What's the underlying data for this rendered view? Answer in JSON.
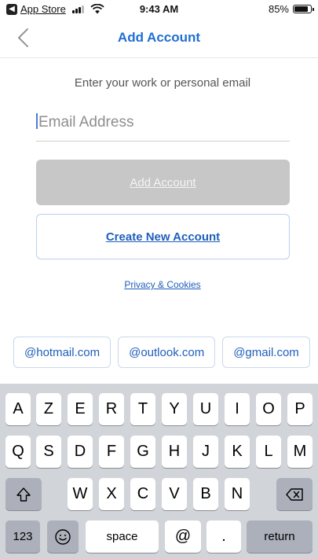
{
  "status_bar": {
    "back_app": "App Store",
    "time": "9:43 AM",
    "battery": "85%",
    "battery_level": 0.85
  },
  "nav": {
    "title": "Add Account"
  },
  "form": {
    "prompt": "Enter your work or personal email",
    "email_placeholder": "Email Address",
    "email_value": "",
    "add_button": "Add Account",
    "create_button": "Create New Account",
    "privacy_link": "Privacy & Cookies"
  },
  "suggestions": [
    "@hotmail.com",
    "@outlook.com",
    "@gmail.com"
  ],
  "keyboard": {
    "row1": [
      "A",
      "Z",
      "E",
      "R",
      "T",
      "Y",
      "U",
      "I",
      "O",
      "P"
    ],
    "row2": [
      "Q",
      "S",
      "D",
      "F",
      "G",
      "H",
      "J",
      "K",
      "L",
      "M"
    ],
    "row3": [
      "W",
      "X",
      "C",
      "V",
      "B",
      "N"
    ],
    "numbers_key": "123",
    "space_key": "space",
    "at_key": "@",
    "dot_key": ".",
    "return_key": "return"
  },
  "icons": {
    "back": "chevron-left-icon",
    "shift": "shift-icon",
    "delete": "backspace-icon",
    "emoji": "emoji-icon"
  },
  "colors": {
    "accent": "#1f6fd1",
    "link": "#1f5fba",
    "disabled_button": "#c7c7c7",
    "keyboard_bg": "#d1d4d9"
  }
}
